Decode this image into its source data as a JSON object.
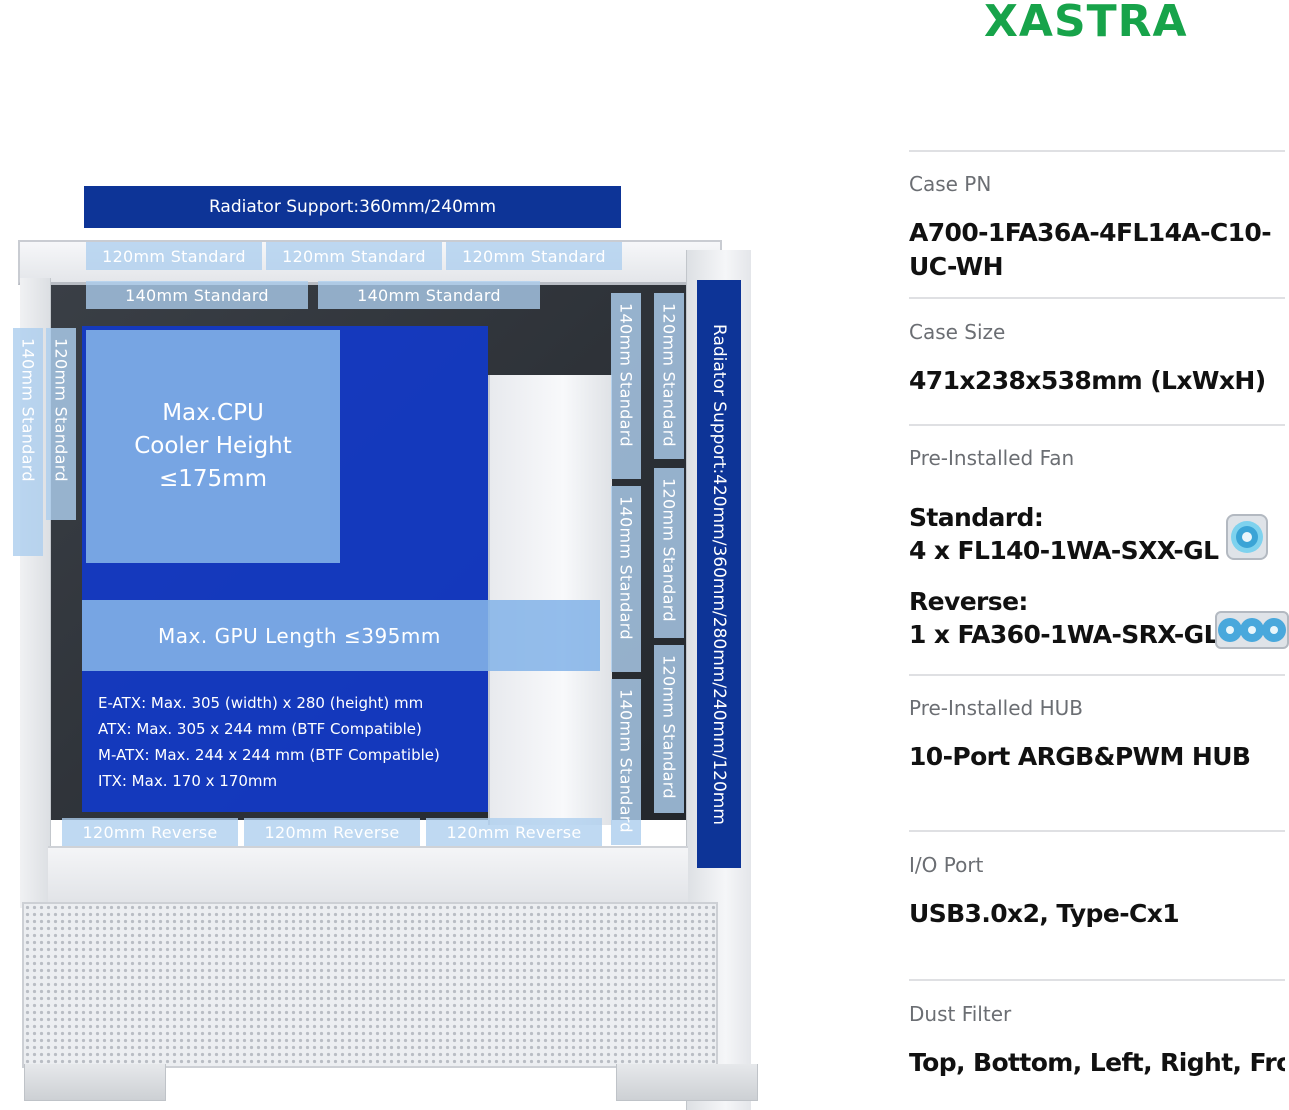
{
  "brand": {
    "logo_text": "XASTRA",
    "logo_color": "#17a34a"
  },
  "colors": {
    "navy": "#0d3497",
    "overlay_blue": "#85b4e8",
    "fan_label": "#adceee",
    "tray_blue": "#123ac8"
  },
  "illustration": {
    "top_radiator": "Radiator Support:360mm/240mm",
    "front_radiator": "Radiator Support:420mm/360mm/280mm/240mm/120mm",
    "top_fans_120": [
      "120mm  Standard",
      "120mm  Standard",
      "120mm  Standard"
    ],
    "top_fans_140": [
      "140mm Standard",
      "140mm Standard"
    ],
    "rear_fan_140": "140mm  Standard",
    "rear_fan_120": "120mm  Standard",
    "front_fans_140": [
      "140mm  Standard",
      "140mm  Standard",
      "140mm  Standard"
    ],
    "front_fans_120": [
      "120mm  Standard",
      "120mm  Standard",
      "120mm  Standard"
    ],
    "bottom_fans": [
      "120mm  Reverse",
      "120mm  Reverse",
      "120mm  Reverse"
    ],
    "cpu_cooler": [
      "Max.CPU",
      "Cooler Height",
      "≤175mm"
    ],
    "gpu_length": "Max. GPU Length  ≤395mm",
    "motherboard": [
      "E-ATX: Max. 305 (width) x 280 (height) mm",
      "ATX: Max. 305 x 244 mm (BTF Compatible)",
      "M-ATX: Max. 244 x 244 mm (BTF Compatible)",
      "ITX: Max. 170 x 170mm"
    ]
  },
  "specs": {
    "case_pn": {
      "label": "Case PN",
      "value_line1": "A700-1FA36A-4FL14A-C10-",
      "value_line2": "UC-WH"
    },
    "case_size": {
      "label": "Case Size",
      "value": "471x238x538mm (LxWxH)"
    },
    "fan": {
      "label": "Pre-Installed Fan",
      "standard_title": "Standard:",
      "standard_value": "4 x FL140-1WA-SXX-GL",
      "reverse_title": "Reverse:",
      "reverse_value": "1 x FA360-1WA-SRX-GL",
      "icons": [
        "single-fan-icon",
        "triple-fan-icon"
      ]
    },
    "hub": {
      "label": "Pre-Installed HUB",
      "value": "10-Port ARGB&PWM HUB"
    },
    "io": {
      "label": "I/O Port",
      "value": "USB3.0x2, Type-Cx1"
    },
    "dust": {
      "label": "Dust Filter",
      "value": "Top, Bottom, Left, Right, Front"
    }
  }
}
